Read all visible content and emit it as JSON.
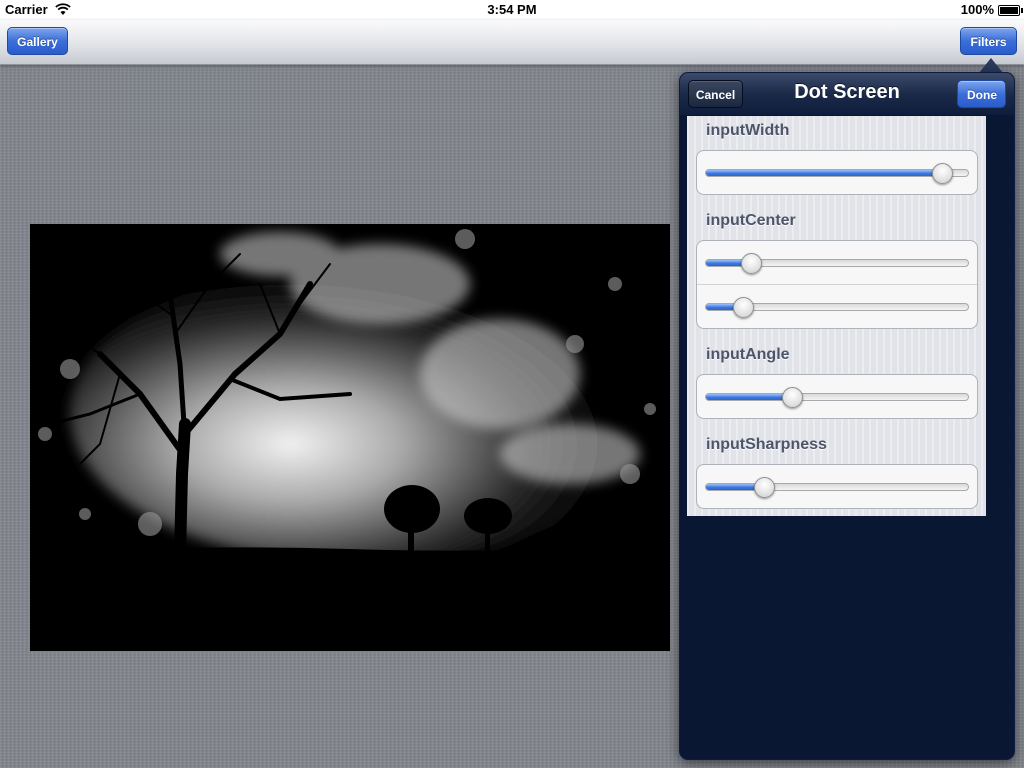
{
  "status_bar": {
    "carrier": "Carrier",
    "time": "3:54 PM",
    "battery": "100%"
  },
  "nav": {
    "left_button": "Gallery",
    "right_button": "Filters"
  },
  "popover": {
    "title": "Dot Screen",
    "cancel": "Cancel",
    "done": "Done",
    "params": [
      {
        "label": "inputWidth",
        "sliders": [
          0.9
        ]
      },
      {
        "label": "inputCenter",
        "sliders": [
          0.17,
          0.14
        ]
      },
      {
        "label": "inputAngle",
        "sliders": [
          0.33
        ]
      },
      {
        "label": "inputSharpness",
        "sliders": [
          0.22
        ]
      }
    ]
  },
  "colors": {
    "accent": "#3b6fd8",
    "popover_bg": "#0a1733",
    "panel_bg": "#e1e3e8"
  }
}
